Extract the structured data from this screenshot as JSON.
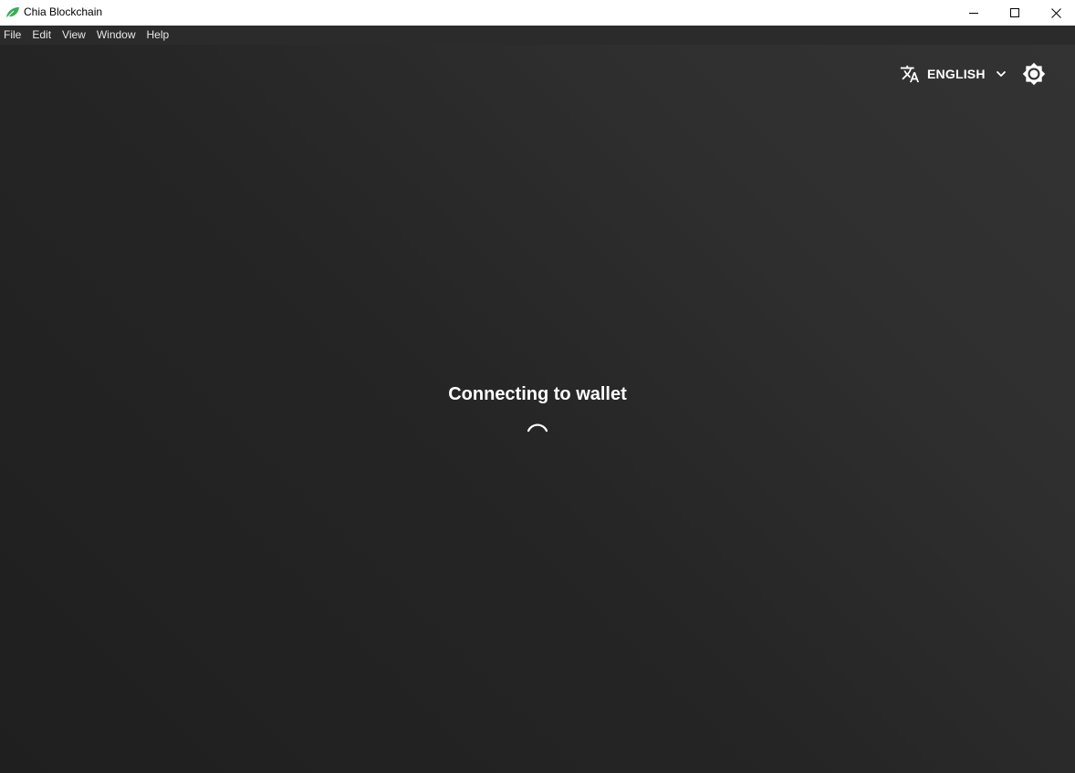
{
  "window": {
    "title": "Chia Blockchain",
    "app_icon": "chia-leaf-icon",
    "controls": [
      "minimize-icon",
      "maximize-icon",
      "close-icon"
    ]
  },
  "menubar": {
    "items": [
      {
        "label": "File"
      },
      {
        "label": "Edit"
      },
      {
        "label": "View"
      },
      {
        "label": "Window"
      },
      {
        "label": "Help"
      }
    ]
  },
  "toolbar": {
    "language": {
      "icon": "translate-icon",
      "label": "ENGLISH",
      "dropdown_icon": "chevron-down-icon"
    },
    "theme_toggle_icon": "brightness-icon"
  },
  "main": {
    "status": "Connecting to wallet",
    "loading_icon": "spinner-icon"
  },
  "colors": {
    "brand": "#3aac59",
    "background": "#262626",
    "text": "#ffffff"
  }
}
